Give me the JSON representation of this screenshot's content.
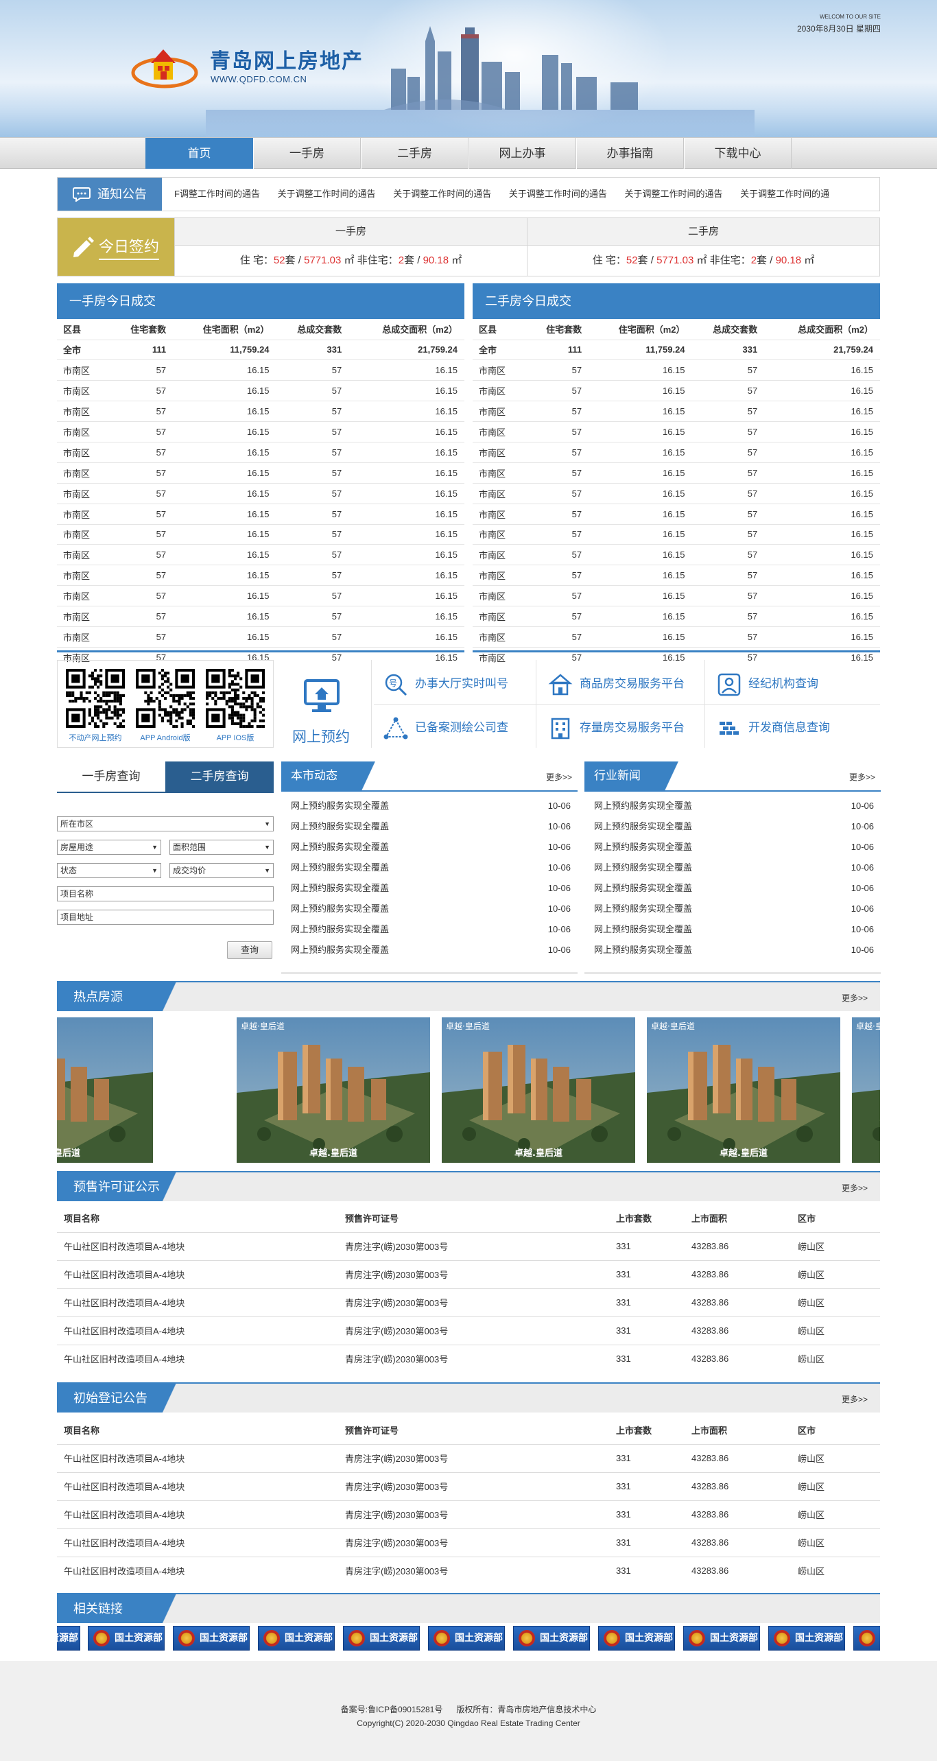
{
  "header": {
    "site_title": "青岛网上房地产",
    "site_url": "WWW.QDFD.COM.CN",
    "welcome": "WELCOM TO OUR SITE",
    "date": "2030年8月30日 星期四"
  },
  "nav": [
    "首页",
    "一手房",
    "二手房",
    "网上办事",
    "办事指南",
    "下载中心"
  ],
  "notice": {
    "title": "通知公告",
    "items": [
      "F调整工作时间的通告",
      "关于调整工作时间的通告",
      "关于调整工作时间的通告",
      "关于调整工作时间的通告",
      "关于调整工作时间的通告",
      "关于调整工作时间的通"
    ]
  },
  "signin": {
    "title": "今日签约",
    "new": {
      "title": "一手房",
      "res_label": "住 宅：",
      "res_count": "52",
      "unit_tao": "套",
      "res_area": "5771.03",
      "area_unit": "㎡",
      "nonres_label": "非住宅：",
      "nonres_count": "2",
      "nonres_area": "90.18"
    },
    "used": {
      "title": "二手房",
      "res_label": "住 宅：",
      "res_count": "52",
      "unit_tao": "套",
      "res_area": "5771.03",
      "area_unit": "㎡",
      "nonres_label": "非住宅：",
      "nonres_count": "2",
      "nonres_area": "90.18"
    }
  },
  "deal_new": {
    "title": "一手房今日成交",
    "headers": [
      "区县",
      "住宅套数",
      "住宅面积（m2）",
      "总成交套数",
      "总成交面积（m2）"
    ],
    "total": [
      "全市",
      "111",
      "11,759.24",
      "331",
      "21,759.24"
    ],
    "row": [
      "市南区",
      "57",
      "16.15",
      "57",
      "16.15"
    ]
  },
  "deal_used": {
    "title": "二手房今日成交",
    "headers": [
      "区县",
      "住宅套数",
      "住宅面积（m2）",
      "总成交套数",
      "总成交面积（m2）"
    ],
    "total": [
      "全市",
      "111",
      "11,759.24",
      "331",
      "21,759.24"
    ],
    "row": [
      "市南区",
      "57",
      "16.15",
      "57",
      "16.15"
    ]
  },
  "quick": {
    "qr_labels": [
      "不动产网上预约",
      "APP Android版",
      "APP IOS版"
    ],
    "booking": "网上预约",
    "services": [
      "办事大厅实时叫号",
      "商品房交易服务平台",
      "经纪机构查询",
      "已备案测绘公司查",
      "存量房交易服务平台",
      "开发商信息查询"
    ]
  },
  "query": {
    "tabs": [
      "一手房查询",
      "二手房查询"
    ],
    "district": "所在市区",
    "usage": "房屋用途",
    "area_range": "面积范围",
    "status": "状态",
    "avg_price": "成交均价",
    "project_name": "项目名称",
    "project_addr": "项目地址",
    "button": "查询"
  },
  "city_news": {
    "title": "本市动态",
    "more": "更多>>",
    "item_title": "网上预约服务实现全覆盖",
    "item_date": "10-06"
  },
  "industry_news": {
    "title": "行业新闻",
    "more": "更多>>",
    "item_title": "网上预约服务实现全覆盖",
    "item_date": "10-06"
  },
  "hot": {
    "title": "热点房源",
    "more": "更多>>",
    "caption_top": "卓越·皇后道",
    "caption_bottom": "卓越.皇后道"
  },
  "permit": {
    "title": "预售许可证公示",
    "more": "更多>>",
    "headers": [
      "项目名称",
      "预售许可证号",
      "上市套数",
      "上市面积",
      "区市"
    ],
    "row": [
      "午山社区旧村改造项目A-4地块",
      "青房注字(崂)2030第003号",
      "331",
      "43283.86",
      "崂山区"
    ]
  },
  "register": {
    "title": "初始登记公告",
    "more": "更多>>",
    "headers": [
      "项目名称",
      "预售许可证号",
      "上市套数",
      "上市面积",
      "区市"
    ],
    "row": [
      "午山社区旧村改造项目A-4地块",
      "青房注字(崂)2030第003号",
      "331",
      "43283.86",
      "崂山区"
    ]
  },
  "links": {
    "title": "相关链接",
    "label": "国土资源部"
  },
  "footer": {
    "record": "备案号:鲁ICP备09015281号",
    "owner": "版权所有：青岛市房地产信息技术中心",
    "copyright": "Copyright(C) 2020-2030 Qingdao Real Estate Trading Center"
  },
  "colors": {
    "primary": "#3a82c4",
    "signin": "#c9b44c",
    "highlight_red": "#d33333",
    "highlight_green": "#2a9a2a"
  }
}
